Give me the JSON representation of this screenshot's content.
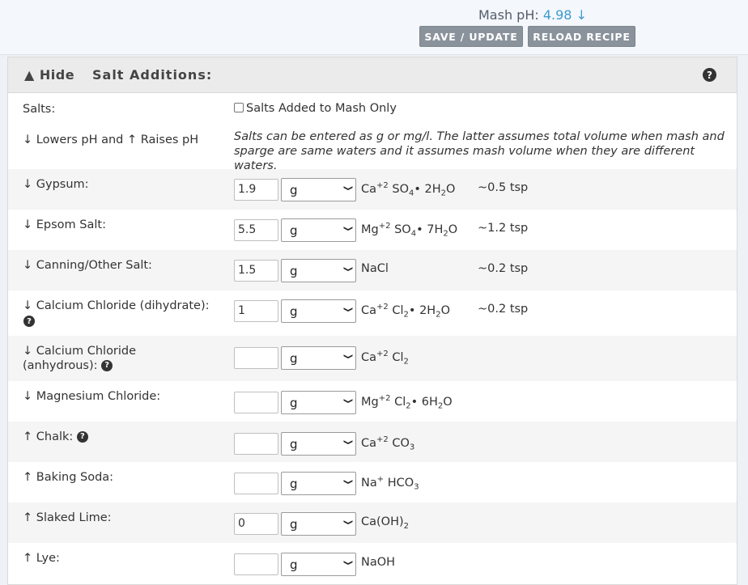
{
  "header": {
    "mash_ph_label": "Mash pH:",
    "mash_ph_value": "4.98",
    "mash_ph_arrow": "↓",
    "save_label": "SAVE / UPDATE",
    "reload_label": "RELOAD RECIPE"
  },
  "panel": {
    "hide_label": "▲ Hide",
    "title": "Salt Additions:",
    "help": "?"
  },
  "salts_row": {
    "label": "Salts:",
    "checkbox_label": "Salts Added to Mash Only",
    "checked": false
  },
  "legend_row": {
    "label": "↓ Lowers pH and ↑ Raises pH",
    "note": "Salts can be entered as g or mg/l. The latter assumes total volume when mash and sparge are same waters and it assumes mash volume when they are different waters."
  },
  "salts": [
    {
      "label": "↓ Gypsum:",
      "value": "1.9",
      "unit": "g",
      "tsp": "~0.5 tsp"
    },
    {
      "label": "↓ Epsom Salt:",
      "value": "5.5",
      "unit": "g",
      "tsp": "~1.2 tsp"
    },
    {
      "label": "↓ Canning/Other Salt:",
      "value": "1.5",
      "unit": "g",
      "tsp": "~0.2 tsp"
    },
    {
      "label": "↓ Calcium Chloride (dihydrate):",
      "value": "1",
      "unit": "g",
      "tsp": "~0.2 tsp"
    },
    {
      "label1": "↓ Calcium Chloride",
      "label2": "(anhydrous):",
      "value": "",
      "unit": "g",
      "tsp": ""
    },
    {
      "label": "↓ Magnesium Chloride:",
      "value": "",
      "unit": "g",
      "tsp": ""
    },
    {
      "label": "↑ Chalk:",
      "value": "",
      "unit": "g",
      "tsp": ""
    },
    {
      "label": "↑ Baking Soda:",
      "value": "",
      "unit": "g",
      "tsp": ""
    },
    {
      "label": "↑ Slaked Lime:",
      "value": "0",
      "unit": "g",
      "tsp": ""
    },
    {
      "label": "↑ Lye:",
      "value": "",
      "unit": "g",
      "tsp": ""
    }
  ],
  "formulas": {
    "gypsum": {
      "a": "Ca",
      "a_sup": "+2",
      "b": " SO",
      "b_sub": "4",
      "c": "• 2H",
      "c_sub": "2",
      "d": "O"
    },
    "epsom": {
      "a": "Mg",
      "a_sup": "+2",
      "b": " SO",
      "b_sub": "4",
      "c": "• 7H",
      "c_sub": "2",
      "d": "O"
    },
    "nacl": {
      "a": "NaCl"
    },
    "cacl2_dihydrate": {
      "a": "Ca",
      "a_sup": "+2",
      "b": " Cl",
      "b_sub": "2",
      "c": "• 2H",
      "c_sub": "2",
      "d": "O"
    },
    "cacl2_anhydrous": {
      "a": "Ca",
      "a_sup": "+2",
      "b": " Cl",
      "b_sub": "2"
    },
    "mgcl2": {
      "a": "Mg",
      "a_sup": "+2",
      "b": " Cl",
      "b_sub": "2",
      "c": "• 6H",
      "c_sub": "2",
      "d": "O"
    },
    "chalk": {
      "a": "Ca",
      "a_sup": "+2",
      "b": " CO",
      "b_sub": "3"
    },
    "baking_soda": {
      "a": "Na",
      "a_sup": "+",
      "b": " HCO",
      "b_sub": "3"
    },
    "slaked_lime": {
      "a": "Ca(OH)",
      "a_sub": "2"
    },
    "lye": {
      "a": "NaOH"
    }
  }
}
